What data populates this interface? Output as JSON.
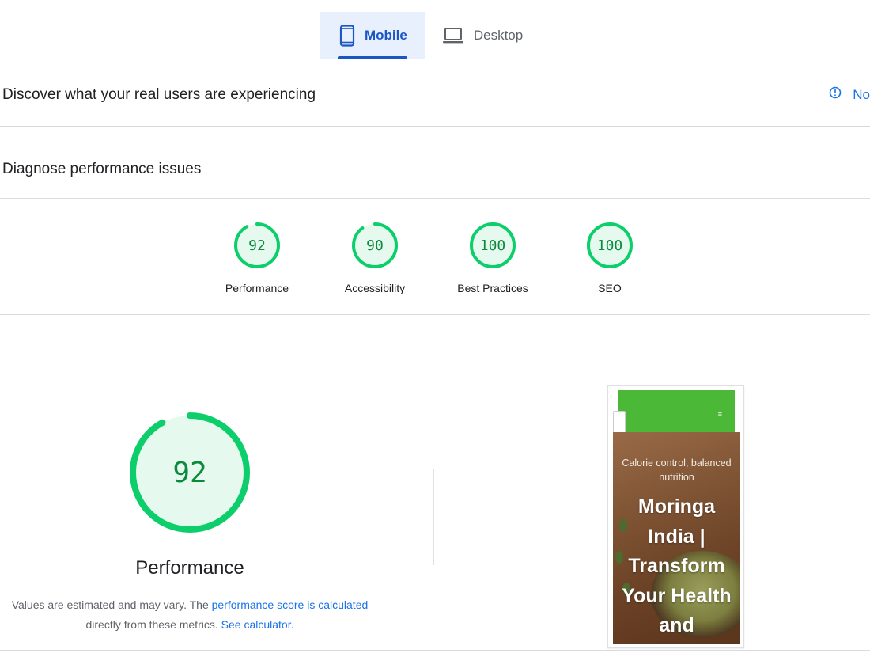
{
  "device_tabs": [
    {
      "label": "Mobile",
      "icon": "smartphone-icon",
      "active": true
    },
    {
      "label": "Desktop",
      "icon": "laptop-icon",
      "active": false
    }
  ],
  "field_section": {
    "title": "Discover what your real users are experiencing",
    "no_data_label": "No"
  },
  "lab_section": {
    "title": "Diagnose performance issues"
  },
  "scores": [
    {
      "label": "Performance",
      "value": "92",
      "fraction": 0.92
    },
    {
      "label": "Accessibility",
      "value": "90",
      "fraction": 0.9
    },
    {
      "label": "Best Practices",
      "value": "100",
      "fraction": 1.0
    },
    {
      "label": "SEO",
      "value": "100",
      "fraction": 1.0
    }
  ],
  "performance": {
    "value": "92",
    "fraction": 0.92,
    "label": "Performance",
    "note_prefix": "Values are estimated and may vary. The ",
    "note_link1": "performance score is calculated",
    "note_middle": "directly from these metrics. ",
    "note_link2": "See calculator",
    "note_suffix": "."
  },
  "colors": {
    "pass": "#0cce6b",
    "pass_fill": "#e6f9ee",
    "pass_text": "#0a8a3c",
    "accent": "#1a56c4",
    "link": "#1a73e8"
  },
  "page_screenshot": {
    "tagline": "Calorie control, balanced nutrition",
    "headline": "Moringa India | Transform Your Health and"
  }
}
